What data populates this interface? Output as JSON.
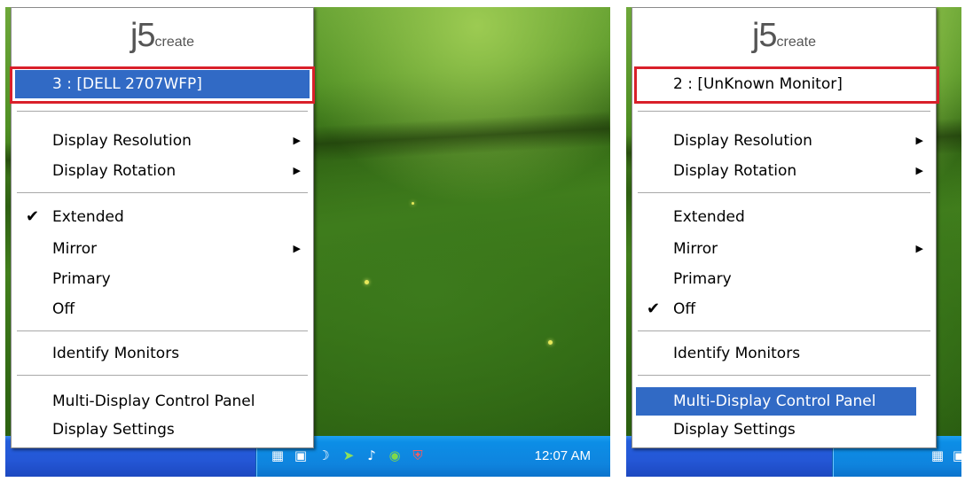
{
  "left_panel": {
    "menu": {
      "logo_j5": "j5",
      "logo_create": "create",
      "monitor_item": "3 : [DELL 2707WFP]",
      "display_resolution": "Display Resolution",
      "display_rotation": "Display Rotation",
      "extended": "Extended",
      "mirror": "Mirror",
      "primary": "Primary",
      "off": "Off",
      "identify_monitors": "Identify Monitors",
      "multi_display_control_panel": "Multi-Display Control Panel",
      "display_settings": "Display Settings",
      "checked_item": "Extended",
      "highlighted_item": "monitor_item"
    },
    "taskbar": {
      "clock": "12:07 AM",
      "tray_icons": [
        "network-icon",
        "j5-icon",
        "moon-icon",
        "green-arrow-icon",
        "speaker-icon",
        "nvidia-icon",
        "security-shield-icon"
      ]
    }
  },
  "right_panel": {
    "menu": {
      "logo_j5": "j5",
      "logo_create": "create",
      "monitor_item": "2 : [UnKnown Monitor]",
      "display_resolution": "Display Resolution",
      "display_rotation": "Display Rotation",
      "extended": "Extended",
      "mirror": "Mirror",
      "primary": "Primary",
      "off": "Off",
      "identify_monitors": "Identify Monitors",
      "multi_display_control_panel": "Multi-Display Control Panel",
      "display_settings": "Display Settings",
      "checked_item": "Off",
      "highlighted_item": "multi_display_control_panel"
    },
    "taskbar": {
      "tray_icons": [
        "network-icon",
        "j5-icon"
      ]
    }
  },
  "symbols": {
    "submenu_arrow": "▶",
    "checkmark": "✔"
  },
  "colors": {
    "highlight": "#316ac5",
    "annotation_box": "#d9202a",
    "taskbar": "#245edb",
    "tray": "#0f84de"
  }
}
